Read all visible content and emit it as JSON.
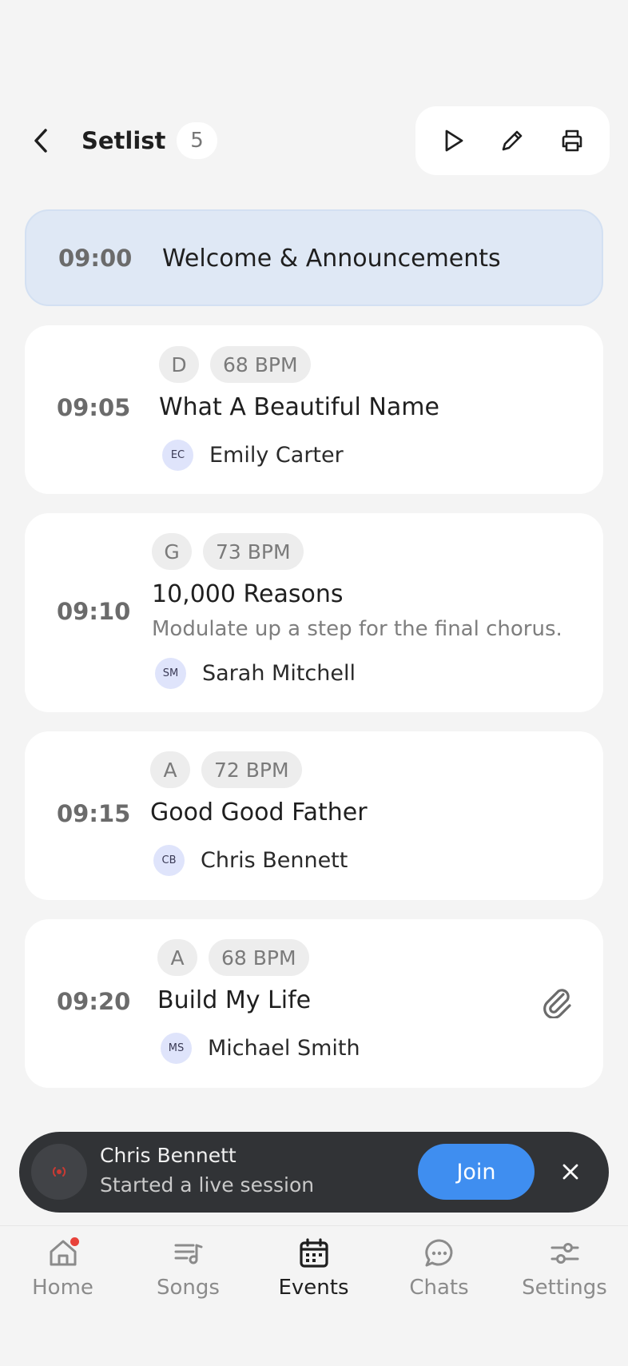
{
  "header": {
    "title": "Setlist",
    "count": "5"
  },
  "items": [
    {
      "time": "09:00",
      "title": "Welcome & Announcements"
    },
    {
      "time": "09:05",
      "key": "D",
      "bpm": "68 BPM",
      "title": "What A Beautiful Name",
      "initials": "EC",
      "person": "Emily Carter"
    },
    {
      "time": "09:10",
      "key": "G",
      "bpm": "73 BPM",
      "title": "10,000 Reasons",
      "note": "Modulate up a step for the final chorus.",
      "initials": "SM",
      "person": "Sarah Mitchell"
    },
    {
      "time": "09:15",
      "key": "A",
      "bpm": "72 BPM",
      "title": "Good Good Father",
      "initials": "CB",
      "person": "Chris Bennett"
    },
    {
      "time": "09:20",
      "key": "A",
      "bpm": "68 BPM",
      "title": "Build My Life",
      "initials": "MS",
      "person": "Michael Smith",
      "has_attachment": true
    }
  ],
  "toast": {
    "name": "Chris Bennett",
    "subtitle": "Started a live session",
    "join_label": "Join"
  },
  "tabs": [
    {
      "label": "Home",
      "icon": "home-icon",
      "has_dot": true
    },
    {
      "label": "Songs",
      "icon": "songs-icon"
    },
    {
      "label": "Events",
      "icon": "calendar-icon",
      "active": true
    },
    {
      "label": "Chats",
      "icon": "chat-icon"
    },
    {
      "label": "Settings",
      "icon": "sliders-icon"
    }
  ],
  "colors": {
    "accent": "#3f8ef0",
    "announcement_bg": "#dfe8f5",
    "toast_bg": "#313336",
    "notification_dot": "#e8423a"
  }
}
